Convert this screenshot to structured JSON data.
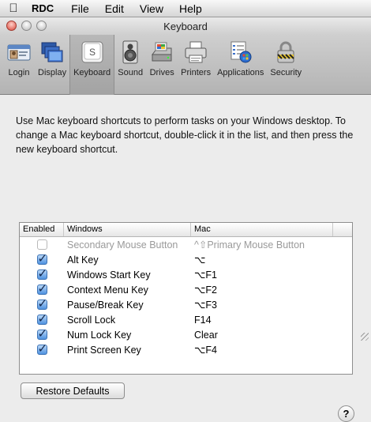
{
  "menubar": {
    "app_name": "RDC",
    "items": [
      "File",
      "Edit",
      "View",
      "Help"
    ]
  },
  "window": {
    "title": "Keyboard"
  },
  "toolbar": {
    "items": [
      {
        "label": "Login",
        "icon": "login-card-icon"
      },
      {
        "label": "Display",
        "icon": "display-monitors-icon"
      },
      {
        "label": "Keyboard",
        "icon": "keyboard-key-icon",
        "selected": true
      },
      {
        "label": "Sound",
        "icon": "speaker-icon"
      },
      {
        "label": "Drives",
        "icon": "drive-icon"
      },
      {
        "label": "Printers",
        "icon": "printer-icon"
      },
      {
        "label": "Applications",
        "icon": "applications-icon"
      },
      {
        "label": "Security",
        "icon": "padlock-icon"
      }
    ],
    "keyboard_key_glyph": "S"
  },
  "description": "Use Mac keyboard shortcuts to perform tasks on your Windows desktop. To change a Mac keyboard shortcut, double-click it in the list, and then press the new keyboard shortcut.",
  "table": {
    "columns": [
      "Enabled",
      "Windows",
      "Mac"
    ],
    "rows": [
      {
        "enabled": false,
        "disabled": true,
        "windows": "Secondary Mouse Button",
        "mac": "^⇧Primary Mouse Button"
      },
      {
        "enabled": true,
        "disabled": false,
        "windows": "Alt Key",
        "mac": "⌥"
      },
      {
        "enabled": true,
        "disabled": false,
        "windows": "Windows Start Key",
        "mac": "⌥F1"
      },
      {
        "enabled": true,
        "disabled": false,
        "windows": "Context Menu Key",
        "mac": "⌥F2"
      },
      {
        "enabled": true,
        "disabled": false,
        "windows": "Pause/Break Key",
        "mac": "⌥F3"
      },
      {
        "enabled": true,
        "disabled": false,
        "windows": "Scroll Lock",
        "mac": "F14"
      },
      {
        "enabled": true,
        "disabled": false,
        "windows": "Num Lock Key",
        "mac": "Clear"
      },
      {
        "enabled": true,
        "disabled": false,
        "windows": "Print Screen Key",
        "mac": "⌥F4"
      }
    ]
  },
  "buttons": {
    "restore_defaults": "Restore Defaults",
    "help": "?"
  }
}
